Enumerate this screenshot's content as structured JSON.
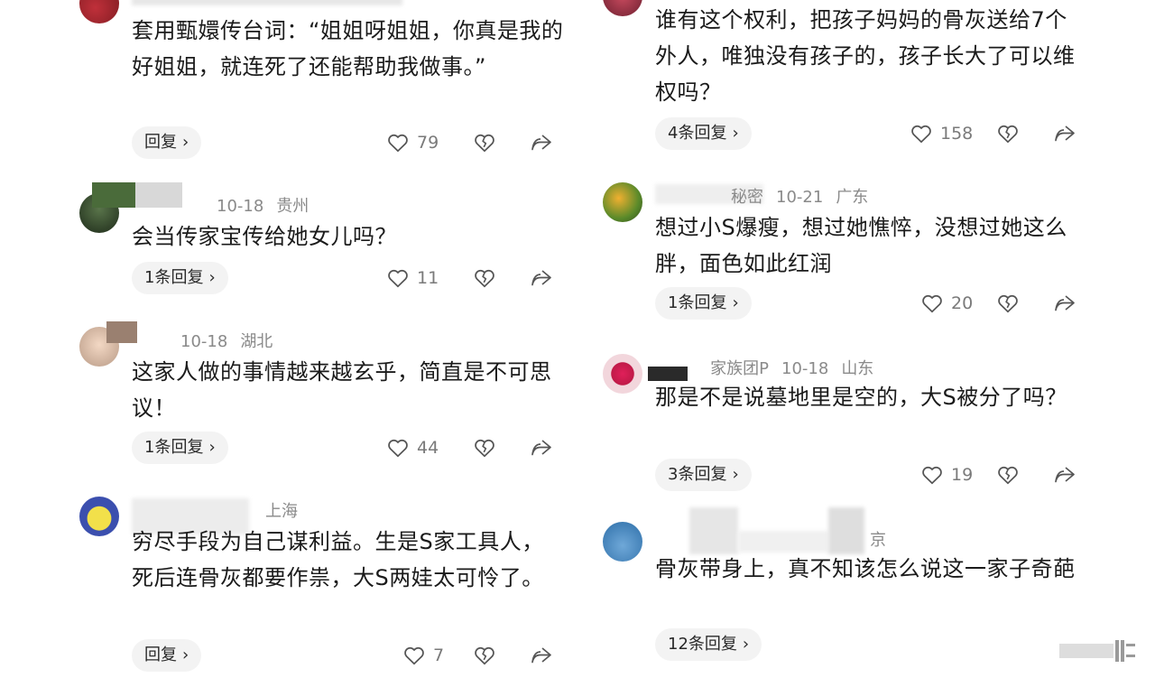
{
  "left": [
    {
      "meta": {
        "name": "",
        "date": "",
        "region": ""
      },
      "text": "套用甄嬛传台词：“姐姐呀姐姐，你真是我的好姐姐，就连死了还能帮助我做事。”",
      "reply_label": "回复",
      "likes": "79"
    },
    {
      "meta": {
        "name": "",
        "date": "10-18",
        "region": "贵州"
      },
      "text": "会当传家宝传给她女儿吗？",
      "reply_label": "1条回复",
      "likes": "11"
    },
    {
      "meta": {
        "name": "",
        "date": "10-18",
        "region": "湖北"
      },
      "text": "这家人做的事情越来越玄乎，简直是不可思议！",
      "reply_label": "1条回复",
      "likes": "44"
    },
    {
      "meta": {
        "name": "",
        "date": "",
        "region": "上海"
      },
      "text": "穷尽手段为自己谋利益。生是S家工具人，死后连骨灰都要作祟，大S两娃太可怜了。",
      "reply_label": "回复",
      "likes": "7"
    }
  ],
  "right": [
    {
      "meta": {
        "name": "",
        "date": "",
        "region": ""
      },
      "text": "谁有这个权利，把孩子妈妈的骨灰送给7个外人，唯独没有孩子的，孩子长大了可以维权吗？",
      "reply_label": "4条回复",
      "likes": "158"
    },
    {
      "meta": {
        "name": "秘密",
        "date": "10-21",
        "region": "广东"
      },
      "text": "想过小S爆瘦，想过她憔悴，没想过她这么胖，面色如此红润",
      "reply_label": "1条回复",
      "likes": "20"
    },
    {
      "meta": {
        "name": "家族团P",
        "date": "10-18",
        "region": "山东"
      },
      "text": "那是不是说墓地里是空的，大S被分了吗？",
      "reply_label": "3条回复",
      "likes": "19"
    },
    {
      "meta": {
        "name": "",
        "date": "",
        "region": "京"
      },
      "text": "骨灰带身上，真不知该怎么说这一家子奇葩",
      "reply_label": "12条回复",
      "likes": ""
    }
  ],
  "icons": {
    "like": "heart-outline-icon",
    "dislike": "broken-heart-icon",
    "share": "share-arrow-icon",
    "chevron": "chevron-right-icon"
  },
  "chevron_glyph": "›",
  "colors": {
    "text": "#1b1b1b",
    "meta": "#8a8a8a",
    "pill": "#f3f3f3",
    "icon": "#555555"
  }
}
